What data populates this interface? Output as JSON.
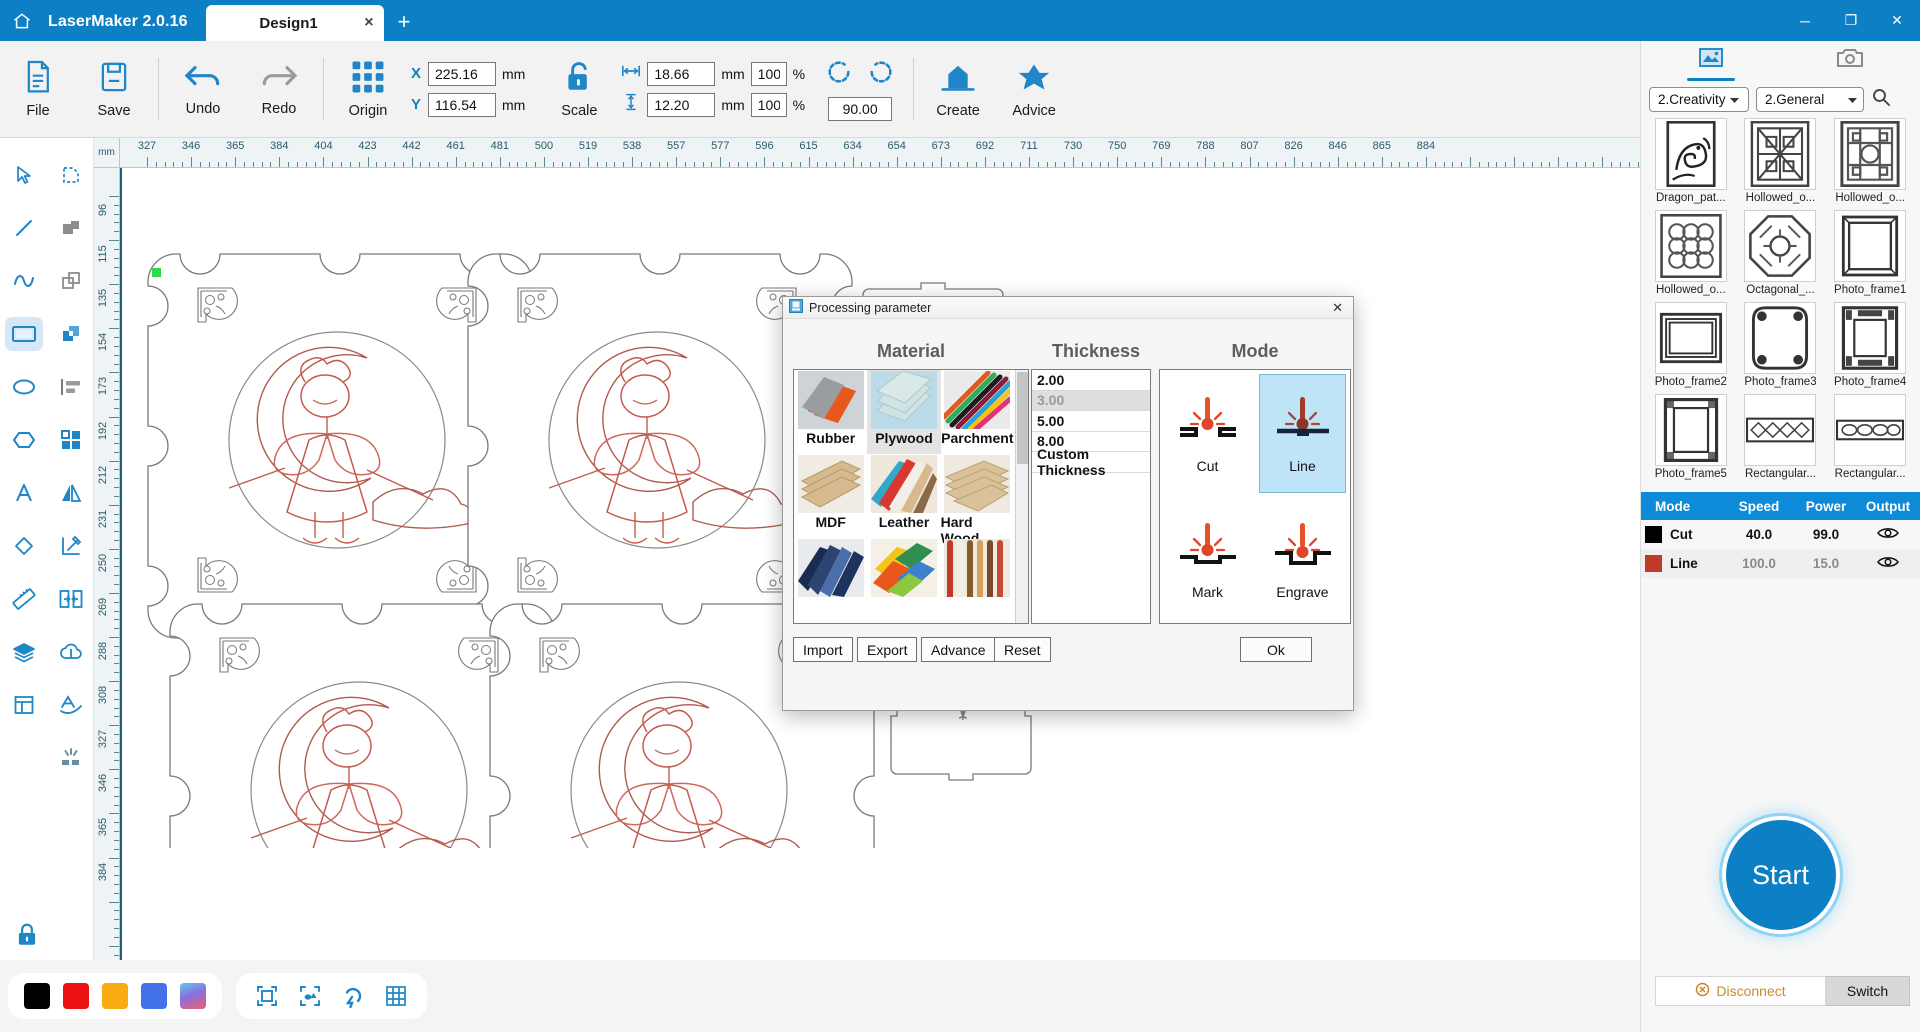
{
  "titlebar": {
    "app_name": "LaserMaker 2.0.16",
    "home_icon": "home-icon",
    "tab_label": "Design1",
    "tab_close": "×",
    "new_tab": "+",
    "minimize": "─",
    "maximize": "❐",
    "close": "✕"
  },
  "ribbon": {
    "file_label": "File",
    "save_label": "Save",
    "undo_label": "Undo",
    "redo_label": "Redo",
    "origin_label": "Origin",
    "scale_label": "Scale",
    "create_label": "Create",
    "advice_label": "Advice",
    "x_axis": "X",
    "y_axis": "Y",
    "x_value": "225.16",
    "y_value": "116.54",
    "width_value": "18.66",
    "height_value": "12.20",
    "width_pct": "100",
    "height_pct": "100",
    "rotation_value": "90.00",
    "unit_mm": "mm",
    "unit_pct": "%"
  },
  "left_tools": [
    {
      "name": "select-tool",
      "selected": false
    },
    {
      "name": "node-edit-tool",
      "selected": false
    },
    {
      "name": "line-tool",
      "selected": false
    },
    {
      "name": "union-tool",
      "selected": false
    },
    {
      "name": "curve-tool",
      "selected": false
    },
    {
      "name": "subtract-tool",
      "selected": false
    },
    {
      "name": "rectangle-tool",
      "selected": true
    },
    {
      "name": "intersect-tool",
      "selected": false
    },
    {
      "name": "ellipse-tool",
      "selected": false
    },
    {
      "name": "align-tool",
      "selected": false
    },
    {
      "name": "polygon-tool",
      "selected": false
    },
    {
      "name": "array-tool",
      "selected": false
    },
    {
      "name": "text-tool",
      "selected": false
    },
    {
      "name": "mirror-tool",
      "selected": false
    },
    {
      "name": "eraser-tool",
      "selected": false
    },
    {
      "name": "measure-angle-tool",
      "selected": false
    },
    {
      "name": "ruler-tool",
      "selected": false
    },
    {
      "name": "distribute-tool",
      "selected": false
    },
    {
      "name": "layers-tool",
      "selected": false
    },
    {
      "name": "cloud-library-tool",
      "selected": false
    },
    {
      "name": "frame-tool",
      "selected": false
    },
    {
      "name": "path-text-tool",
      "selected": false
    },
    {
      "name": "blank-tool",
      "selected": false
    },
    {
      "name": "explode-tool",
      "selected": false
    }
  ],
  "lock_icon": "lock-icon",
  "canvas": {
    "unit_label": "mm",
    "h_ruler_labels": [
      "327",
      "346",
      "365",
      "384",
      "404",
      "423",
      "442",
      "461",
      "481",
      "500",
      "519",
      "538",
      "557",
      "577",
      "596",
      "615",
      "634",
      "654",
      "673",
      "692",
      "711",
      "730",
      "750",
      "769",
      "788",
      "807",
      "826",
      "846",
      "865",
      "884"
    ],
    "v_ruler_labels": [
      "96",
      "115",
      "135",
      "154",
      "173",
      "192",
      "212",
      "231",
      "250",
      "269",
      "288",
      "308",
      "327",
      "346",
      "365",
      "384"
    ]
  },
  "bottom_bar": {
    "colors": [
      {
        "name": "swatch-black",
        "hex": "#000000"
      },
      {
        "name": "swatch-red",
        "hex": "#ee1111"
      },
      {
        "name": "swatch-orange",
        "hex": "#f8ab12"
      },
      {
        "name": "swatch-blue",
        "hex": "#4271e8"
      },
      {
        "name": "swatch-gradient",
        "hex": "#7fc4ef"
      }
    ],
    "tools": [
      {
        "name": "fit-to-frame-icon"
      },
      {
        "name": "select-shapes-icon"
      },
      {
        "name": "magnet-snap-icon"
      },
      {
        "name": "grid-icon"
      }
    ]
  },
  "right_panel": {
    "tabs": [
      {
        "name": "library-tab",
        "icon": "image-library-icon",
        "active": true
      },
      {
        "name": "camera-tab",
        "icon": "camera-icon",
        "active": false
      }
    ],
    "category_primary": "2.Creativity",
    "category_secondary": "2.General",
    "search_icon": "search-icon",
    "library_items": [
      {
        "caption": "Dragon_pat...",
        "art": "dragon"
      },
      {
        "caption": "Hollowed_o...",
        "art": "lattice1"
      },
      {
        "caption": "Hollowed_o...",
        "art": "lattice2"
      },
      {
        "caption": "Hollowed_o...",
        "art": "lattice3"
      },
      {
        "caption": "Octagonal_...",
        "art": "octagon"
      },
      {
        "caption": "Photo_frame1",
        "art": "frame1"
      },
      {
        "caption": "Photo_frame2",
        "art": "frame2"
      },
      {
        "caption": "Photo_frame3",
        "art": "frame3"
      },
      {
        "caption": "Photo_frame4",
        "art": "frame4"
      },
      {
        "caption": "Photo_frame5",
        "art": "frame5"
      },
      {
        "caption": "Rectangular...",
        "art": "bar1"
      },
      {
        "caption": "Rectangular...",
        "art": "bar2"
      }
    ],
    "layer_table": {
      "headers": [
        "Mode",
        "Speed",
        "Power",
        "Output"
      ],
      "rows": [
        {
          "color": "#000000",
          "mode": "Cut",
          "speed": "40.0",
          "power": "99.0",
          "output_icon": "eye-icon",
          "dim": false
        },
        {
          "color": "#c0392b",
          "mode": "Line",
          "speed": "100.0",
          "power": "15.0",
          "output_icon": "eye-icon",
          "dim": true
        }
      ]
    },
    "start_label": "Start",
    "disconnect_label": "Disconnect",
    "disconnect_icon": "disconnect-icon",
    "switch_label": "Switch"
  },
  "dialog": {
    "title": "Processing parameter",
    "title_icon": "app-icon",
    "close_icon": "✕",
    "material_heading": "Material",
    "thickness_heading": "Thickness",
    "mode_heading": "Mode",
    "materials": [
      {
        "label": "Rubber",
        "art": "rubber",
        "selected": false
      },
      {
        "label": "Plywood",
        "art": "plywood",
        "selected": true
      },
      {
        "label": "Parchment",
        "art": "parchment",
        "selected": false
      },
      {
        "label": "MDF",
        "art": "mdf",
        "selected": false
      },
      {
        "label": "Leather",
        "art": "leather",
        "selected": false
      },
      {
        "label": "Hard Wood",
        "art": "hardwood",
        "selected": false
      },
      {
        "label": "",
        "art": "denim",
        "selected": false
      },
      {
        "label": "",
        "art": "paper",
        "selected": false
      },
      {
        "label": "",
        "art": "felt",
        "selected": false
      }
    ],
    "thicknesses": [
      {
        "label": "2.00",
        "selected": false
      },
      {
        "label": "3.00",
        "selected": true
      },
      {
        "label": "5.00",
        "selected": false
      },
      {
        "label": "8.00",
        "selected": false
      },
      {
        "label": "Custom Thickness",
        "selected": false
      }
    ],
    "modes": [
      {
        "label": "Cut",
        "icon": "laser-cut-icon",
        "selected": false
      },
      {
        "label": "Line",
        "icon": "laser-line-icon",
        "selected": true
      },
      {
        "label": "Mark",
        "icon": "laser-mark-icon",
        "selected": false
      },
      {
        "label": "Engrave",
        "icon": "laser-engrave-icon",
        "selected": false
      }
    ],
    "buttons": {
      "import": "Import",
      "export": "Export",
      "advance": "Advance",
      "reset": "Reset",
      "ok": "Ok"
    }
  }
}
